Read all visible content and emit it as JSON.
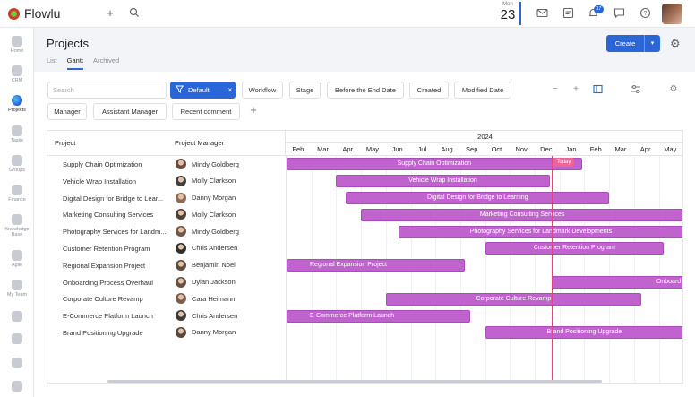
{
  "app": {
    "name": "Flowlu"
  },
  "topbar": {
    "date_day": "Mon",
    "date_num": "23",
    "notification_count": "17"
  },
  "sidebar": {
    "items": [
      {
        "label": "Home",
        "icon": "home-icon"
      },
      {
        "label": "CRM",
        "icon": "crm-icon"
      },
      {
        "label": "Projects",
        "icon": "projects-icon",
        "active": true
      },
      {
        "label": "Tasks",
        "icon": "tasks-icon"
      },
      {
        "label": "Groups",
        "icon": "groups-icon"
      },
      {
        "label": "Finance",
        "icon": "finance-icon"
      },
      {
        "label": "Knowledge Base",
        "icon": "knowledge-base-icon"
      },
      {
        "label": "Agile",
        "icon": "agile-icon"
      },
      {
        "label": "My Team",
        "icon": "my-team-icon"
      }
    ]
  },
  "page": {
    "title": "Projects",
    "tabs": [
      {
        "label": "List"
      },
      {
        "label": "Gantt",
        "active": true
      },
      {
        "label": "Archived"
      }
    ],
    "create_label": "Create"
  },
  "filters": {
    "search_placeholder": "Search",
    "active_filter": "Default",
    "chips": [
      "Workflow",
      "Stage",
      "Before the End Date",
      "Created",
      "Modified Date",
      "Manager",
      "Assistant Manager",
      "Recent comment"
    ]
  },
  "gantt": {
    "col_project": "Project",
    "col_manager": "Project Manager",
    "year": "2024",
    "months": [
      "Feb",
      "Mar",
      "Apr",
      "May",
      "Jun",
      "Jul",
      "Aug",
      "Sep",
      "Oct",
      "Nov",
      "Dec",
      "Jan",
      "Feb",
      "Mar",
      "Apr",
      "May"
    ],
    "today_label": "Today",
    "bar_color": "#c063cf",
    "rows": [
      {
        "project": "Supply Chain Optimization",
        "manager": "Mindy Goldberg",
        "bar_label": "Supply Chain Optimization",
        "start_month": 0,
        "end_month": 11.9
      },
      {
        "project": "Vehicle Wrap Installation",
        "manager": "Molly Clarkson",
        "bar_label": "Vehicle Wrap Installation",
        "start_month": 2.0,
        "end_month": 10.6
      },
      {
        "project": "Digital Design for Bridge to Lear...",
        "manager": "Danny Morgan",
        "bar_label": "Digital Design for Bridge to Learning",
        "start_month": 2.4,
        "end_month": 13.0
      },
      {
        "project": "Marketing Consulting Services",
        "manager": "Molly Clarkson",
        "bar_label": "Marketing Consulting Services",
        "start_month": 3.0,
        "end_month": 16.0
      },
      {
        "project": "Photography Services for Landm...",
        "manager": "Mindy Goldberg",
        "bar_label": "Photography Services for Landmark Developments",
        "start_month": 4.5,
        "end_month": 16.0
      },
      {
        "project": "Customer Retention Program",
        "manager": "Chris Andersen",
        "bar_label": "Customer Retention Program",
        "start_month": 8.0,
        "end_month": 15.2
      },
      {
        "project": "Regional Expansion Project",
        "manager": "Benjamin Noel",
        "bar_label": "Regional Expansion Project",
        "start_month": 0,
        "end_month": 7.2
      },
      {
        "project": "Onboarding Process Overhaul",
        "manager": "Dylan Jackson",
        "bar_label": "Onboard",
        "start_month": 10.7,
        "end_month": 16.0
      },
      {
        "project": "Corporate Culture Revamp",
        "manager": "Cara Heimann",
        "bar_label": "Corporate Culture Revamp",
        "start_month": 4.0,
        "end_month": 14.3
      },
      {
        "project": "E-Commerce Platform Launch",
        "manager": "Chris Andersen",
        "bar_label": "E-Commerce Platform Launch",
        "start_month": 0,
        "end_month": 7.4
      },
      {
        "project": "Brand Positioning Upgrade",
        "manager": "Danny Morgan",
        "bar_label": "Brand Positioning Upgrade",
        "start_month": 8.0,
        "end_month": 16.0
      }
    ],
    "today_month": 10.7
  }
}
